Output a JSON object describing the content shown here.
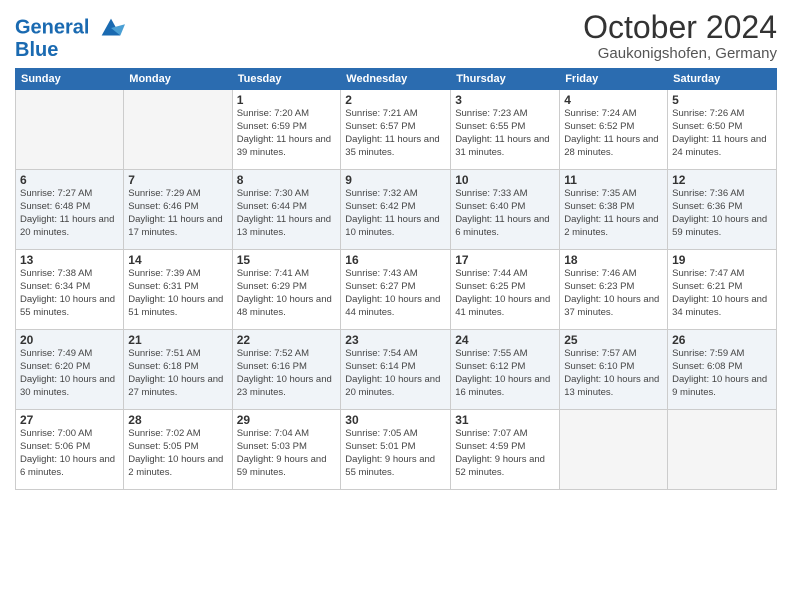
{
  "header": {
    "logo_line1": "General",
    "logo_line2": "Blue",
    "month": "October 2024",
    "location": "Gaukonigshofen, Germany"
  },
  "weekdays": [
    "Sunday",
    "Monday",
    "Tuesday",
    "Wednesday",
    "Thursday",
    "Friday",
    "Saturday"
  ],
  "weeks": [
    [
      {
        "day": "",
        "sunrise": "",
        "sunset": "",
        "daylight": ""
      },
      {
        "day": "",
        "sunrise": "",
        "sunset": "",
        "daylight": ""
      },
      {
        "day": "1",
        "sunrise": "Sunrise: 7:20 AM",
        "sunset": "Sunset: 6:59 PM",
        "daylight": "Daylight: 11 hours and 39 minutes."
      },
      {
        "day": "2",
        "sunrise": "Sunrise: 7:21 AM",
        "sunset": "Sunset: 6:57 PM",
        "daylight": "Daylight: 11 hours and 35 minutes."
      },
      {
        "day": "3",
        "sunrise": "Sunrise: 7:23 AM",
        "sunset": "Sunset: 6:55 PM",
        "daylight": "Daylight: 11 hours and 31 minutes."
      },
      {
        "day": "4",
        "sunrise": "Sunrise: 7:24 AM",
        "sunset": "Sunset: 6:52 PM",
        "daylight": "Daylight: 11 hours and 28 minutes."
      },
      {
        "day": "5",
        "sunrise": "Sunrise: 7:26 AM",
        "sunset": "Sunset: 6:50 PM",
        "daylight": "Daylight: 11 hours and 24 minutes."
      }
    ],
    [
      {
        "day": "6",
        "sunrise": "Sunrise: 7:27 AM",
        "sunset": "Sunset: 6:48 PM",
        "daylight": "Daylight: 11 hours and 20 minutes."
      },
      {
        "day": "7",
        "sunrise": "Sunrise: 7:29 AM",
        "sunset": "Sunset: 6:46 PM",
        "daylight": "Daylight: 11 hours and 17 minutes."
      },
      {
        "day": "8",
        "sunrise": "Sunrise: 7:30 AM",
        "sunset": "Sunset: 6:44 PM",
        "daylight": "Daylight: 11 hours and 13 minutes."
      },
      {
        "day": "9",
        "sunrise": "Sunrise: 7:32 AM",
        "sunset": "Sunset: 6:42 PM",
        "daylight": "Daylight: 11 hours and 10 minutes."
      },
      {
        "day": "10",
        "sunrise": "Sunrise: 7:33 AM",
        "sunset": "Sunset: 6:40 PM",
        "daylight": "Daylight: 11 hours and 6 minutes."
      },
      {
        "day": "11",
        "sunrise": "Sunrise: 7:35 AM",
        "sunset": "Sunset: 6:38 PM",
        "daylight": "Daylight: 11 hours and 2 minutes."
      },
      {
        "day": "12",
        "sunrise": "Sunrise: 7:36 AM",
        "sunset": "Sunset: 6:36 PM",
        "daylight": "Daylight: 10 hours and 59 minutes."
      }
    ],
    [
      {
        "day": "13",
        "sunrise": "Sunrise: 7:38 AM",
        "sunset": "Sunset: 6:34 PM",
        "daylight": "Daylight: 10 hours and 55 minutes."
      },
      {
        "day": "14",
        "sunrise": "Sunrise: 7:39 AM",
        "sunset": "Sunset: 6:31 PM",
        "daylight": "Daylight: 10 hours and 51 minutes."
      },
      {
        "day": "15",
        "sunrise": "Sunrise: 7:41 AM",
        "sunset": "Sunset: 6:29 PM",
        "daylight": "Daylight: 10 hours and 48 minutes."
      },
      {
        "day": "16",
        "sunrise": "Sunrise: 7:43 AM",
        "sunset": "Sunset: 6:27 PM",
        "daylight": "Daylight: 10 hours and 44 minutes."
      },
      {
        "day": "17",
        "sunrise": "Sunrise: 7:44 AM",
        "sunset": "Sunset: 6:25 PM",
        "daylight": "Daylight: 10 hours and 41 minutes."
      },
      {
        "day": "18",
        "sunrise": "Sunrise: 7:46 AM",
        "sunset": "Sunset: 6:23 PM",
        "daylight": "Daylight: 10 hours and 37 minutes."
      },
      {
        "day": "19",
        "sunrise": "Sunrise: 7:47 AM",
        "sunset": "Sunset: 6:21 PM",
        "daylight": "Daylight: 10 hours and 34 minutes."
      }
    ],
    [
      {
        "day": "20",
        "sunrise": "Sunrise: 7:49 AM",
        "sunset": "Sunset: 6:20 PM",
        "daylight": "Daylight: 10 hours and 30 minutes."
      },
      {
        "day": "21",
        "sunrise": "Sunrise: 7:51 AM",
        "sunset": "Sunset: 6:18 PM",
        "daylight": "Daylight: 10 hours and 27 minutes."
      },
      {
        "day": "22",
        "sunrise": "Sunrise: 7:52 AM",
        "sunset": "Sunset: 6:16 PM",
        "daylight": "Daylight: 10 hours and 23 minutes."
      },
      {
        "day": "23",
        "sunrise": "Sunrise: 7:54 AM",
        "sunset": "Sunset: 6:14 PM",
        "daylight": "Daylight: 10 hours and 20 minutes."
      },
      {
        "day": "24",
        "sunrise": "Sunrise: 7:55 AM",
        "sunset": "Sunset: 6:12 PM",
        "daylight": "Daylight: 10 hours and 16 minutes."
      },
      {
        "day": "25",
        "sunrise": "Sunrise: 7:57 AM",
        "sunset": "Sunset: 6:10 PM",
        "daylight": "Daylight: 10 hours and 13 minutes."
      },
      {
        "day": "26",
        "sunrise": "Sunrise: 7:59 AM",
        "sunset": "Sunset: 6:08 PM",
        "daylight": "Daylight: 10 hours and 9 minutes."
      }
    ],
    [
      {
        "day": "27",
        "sunrise": "Sunrise: 7:00 AM",
        "sunset": "Sunset: 5:06 PM",
        "daylight": "Daylight: 10 hours and 6 minutes."
      },
      {
        "day": "28",
        "sunrise": "Sunrise: 7:02 AM",
        "sunset": "Sunset: 5:05 PM",
        "daylight": "Daylight: 10 hours and 2 minutes."
      },
      {
        "day": "29",
        "sunrise": "Sunrise: 7:04 AM",
        "sunset": "Sunset: 5:03 PM",
        "daylight": "Daylight: 9 hours and 59 minutes."
      },
      {
        "day": "30",
        "sunrise": "Sunrise: 7:05 AM",
        "sunset": "Sunset: 5:01 PM",
        "daylight": "Daylight: 9 hours and 55 minutes."
      },
      {
        "day": "31",
        "sunrise": "Sunrise: 7:07 AM",
        "sunset": "Sunset: 4:59 PM",
        "daylight": "Daylight: 9 hours and 52 minutes."
      },
      {
        "day": "",
        "sunrise": "",
        "sunset": "",
        "daylight": ""
      },
      {
        "day": "",
        "sunrise": "",
        "sunset": "",
        "daylight": ""
      }
    ]
  ]
}
